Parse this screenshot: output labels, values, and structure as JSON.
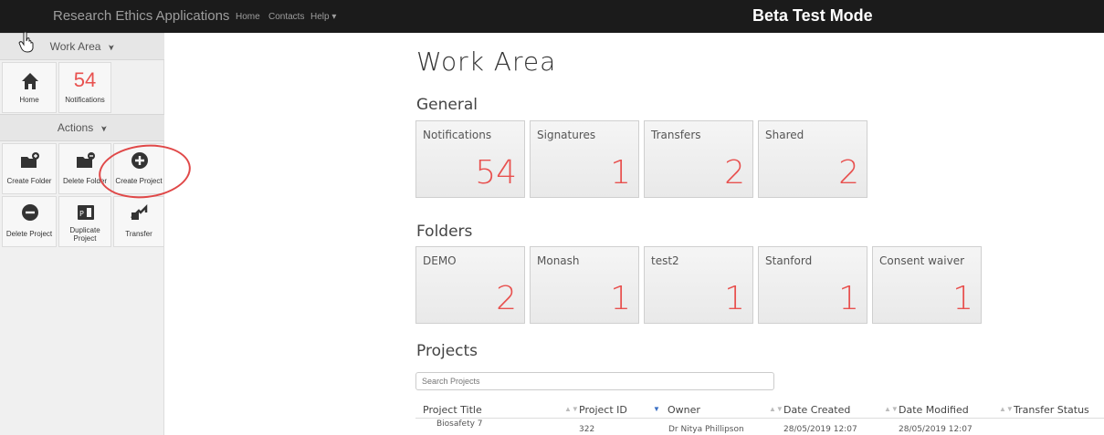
{
  "navbar": {
    "brand": "Research Ethics Applications",
    "links": [
      "Home",
      "Contacts",
      "Help ▾"
    ],
    "beta": "Beta Test Mode"
  },
  "sidebar": {
    "work_area_header": "Work Area",
    "home_label": "Home",
    "notifications_count": "54",
    "notifications_label": "Notifications",
    "actions_header": "Actions",
    "actions": [
      {
        "label": "Create Folder",
        "icon": "folder-plus-icon"
      },
      {
        "label": "Delete Folder",
        "icon": "folder-minus-icon"
      },
      {
        "label": "Create Project",
        "icon": "plus-circle-icon"
      },
      {
        "label": "Delete Project",
        "icon": "minus-circle-icon"
      },
      {
        "label": "Duplicate Project",
        "icon": "duplicate-icon"
      },
      {
        "label": "Transfer",
        "icon": "transfer-icon"
      }
    ]
  },
  "main": {
    "title": "Work Area",
    "general_title": "General",
    "general": [
      {
        "label": "Notifications",
        "count": "54"
      },
      {
        "label": "Signatures",
        "count": "1"
      },
      {
        "label": "Transfers",
        "count": "2"
      },
      {
        "label": "Shared",
        "count": "2"
      }
    ],
    "folders_title": "Folders",
    "folders": [
      {
        "label": "DEMO",
        "count": "2"
      },
      {
        "label": "Monash",
        "count": "1"
      },
      {
        "label": "test2",
        "count": "1"
      },
      {
        "label": "Stanford",
        "count": "1"
      },
      {
        "label": "Consent waiver",
        "count": "1"
      }
    ],
    "projects_title": "Projects",
    "search_placeholder": "Search Projects",
    "columns": [
      "Project Title",
      "Project ID",
      "Owner",
      "Date Created",
      "Date Modified",
      "Transfer Status"
    ],
    "rows": [
      [
        "Biosafety 7",
        "322",
        "Dr Nitya Phillipson",
        "28/05/2019 12:07",
        "28/05/2019 12:07",
        ""
      ]
    ]
  },
  "colors": {
    "accent_red": "#e8514f",
    "navbar_bg": "#1b1b1b"
  }
}
